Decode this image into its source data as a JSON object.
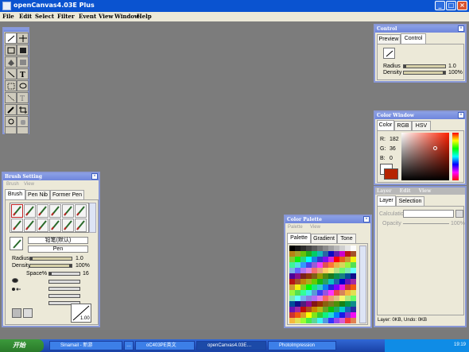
{
  "window": {
    "title": "openCanvas4.03E Plus"
  },
  "menu": [
    "File",
    "Edit",
    "Select",
    "Filter",
    "Event",
    "View",
    "Window",
    "Help"
  ],
  "control": {
    "title": "Control",
    "tabs": [
      "Preview",
      "Control"
    ],
    "radius_label": "Radius",
    "radius_value": "1.0",
    "density_label": "Density",
    "density_value": "100%",
    "radius_level": 0.0,
    "density_level": 1.0
  },
  "color_window": {
    "title": "Color Window",
    "tabs": [
      "Color",
      "RGB",
      "HSV"
    ],
    "r_label": "R:",
    "r_value": "182",
    "g_label": "G:",
    "g_value": "36",
    "b_label": "B:",
    "b_value": "0",
    "current_color": "#b62400"
  },
  "layer": {
    "menu": [
      "Layer",
      "Edit",
      "View"
    ],
    "tabs": [
      "Layer",
      "Selection"
    ],
    "calc_label": "Calculation",
    "opacity_label": "Opacity",
    "opacity_value": "100%",
    "status": "Layer: 0KB, Undo: 0KB"
  },
  "brush": {
    "title": "Brush Setting",
    "menu": [
      "Brush",
      "View"
    ],
    "tabs": [
      "Brush",
      "Pen Nib",
      "Former Pen"
    ],
    "name": "铅笔(默认)",
    "type": "Pen",
    "radius_label": "Radius",
    "radius_value": "1.0",
    "density_label": "Density",
    "density_value": "100%",
    "space_label": "Space%",
    "space_value": "16",
    "curve_value": "1.00"
  },
  "palette": {
    "title": "Color Palette",
    "menu": [
      "Palette",
      "View"
    ],
    "tabs": [
      "Palette",
      "Gradient",
      "Tone"
    ]
  },
  "taskbar": {
    "start": "开始",
    "tasks": [
      "Sinamail - 新游",
      "…",
      "oC403PE英文",
      "openCanvas4.03E…",
      "PhotoImpression"
    ],
    "clock": "19:19"
  },
  "colors": {
    "titlebar": "#0a53d0",
    "panel_title": "#7b90e0",
    "accent": "#b62400"
  }
}
